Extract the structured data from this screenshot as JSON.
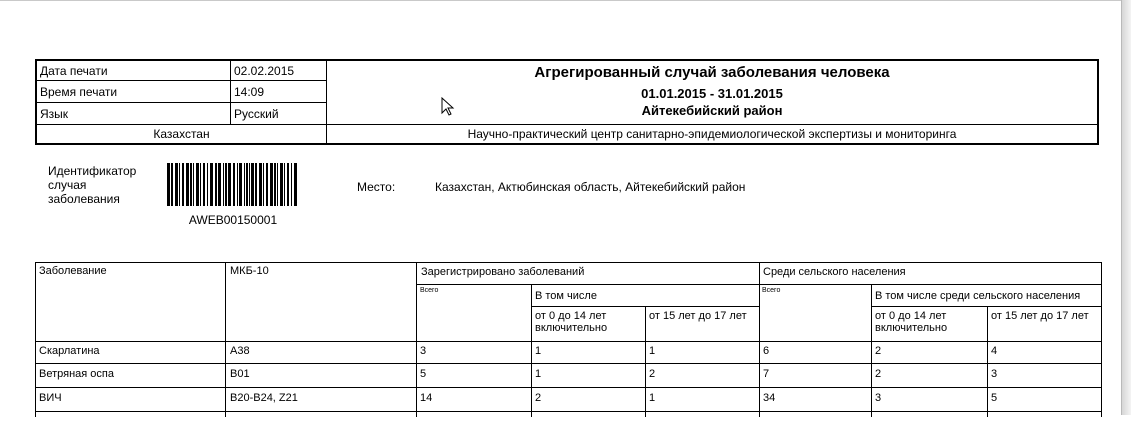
{
  "header": {
    "print_date_label": "Дата печати",
    "print_date_value": "02.02.2015",
    "print_time_label": "Время печати",
    "print_time_value": "14:09",
    "language_label": "Язык",
    "language_value": "Русский",
    "country": "Казахстан",
    "title": "Агрегированный случай заболевания человека",
    "period": "01.01.2015 - 31.01.2015",
    "district": "Айтекебийский район",
    "organization": "Научно-практический центр санитарно-эпидемиологической экспертизы и мониторинга"
  },
  "case": {
    "id_label": "Идентификатор случая заболевания",
    "barcode_text": "AWEB00150001",
    "place_label": "Место:",
    "place_value": "Казахстан, Актюбинская область, Айтекебийский район"
  },
  "table": {
    "col_disease": "Заболевание",
    "col_icd": "МКБ-10",
    "col_registered": "Зарегистрировано заболеваний",
    "col_rural": "Среди сельского населения",
    "col_total": "Всего",
    "col_total_rural": "Всего",
    "col_including": "В том числе",
    "col_including_rural": "В том числе среди сельского населения",
    "col_0_14": "от 0 до 14 лет включительно",
    "col_15_17": "от 15 лет до 17 лет",
    "col_0_14_rural": "от 0 до 14 лет включительно",
    "col_15_17_rural": "от 15 лет до 17 лет",
    "rows": [
      {
        "disease": "Скарлатина",
        "icd": "A38",
        "total": "3",
        "age_0_14": "1",
        "age_15_17": "1",
        "rural_total": "6",
        "rural_0_14": "2",
        "rural_15_17": "4"
      },
      {
        "disease": "Ветряная оспа",
        "icd": "B01",
        "total": "5",
        "age_0_14": "1",
        "age_15_17": "2",
        "rural_total": "7",
        "rural_0_14": "2",
        "rural_15_17": "3"
      },
      {
        "disease": "ВИЧ",
        "icd": "B20-B24, Z21",
        "total": "14",
        "age_0_14": "2",
        "age_15_17": "1",
        "rural_total": "34",
        "rural_0_14": "3",
        "rural_15_17": "5"
      }
    ]
  }
}
